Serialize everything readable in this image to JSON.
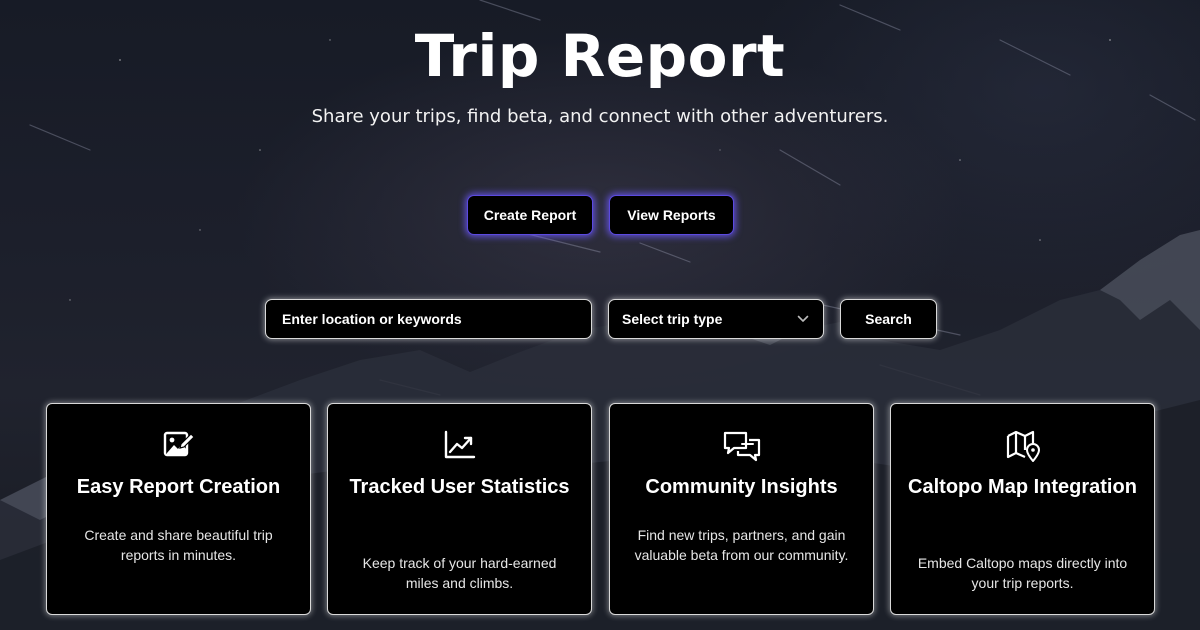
{
  "hero": {
    "title": "Trip Report",
    "subtitle": "Share your trips, find beta, and connect with other adventurers."
  },
  "actions": {
    "create_label": "Create Report",
    "view_label": "View Reports"
  },
  "search": {
    "placeholder": "Enter location or keywords",
    "trip_type_selected": "Select trip type",
    "button_label": "Search"
  },
  "features": [
    {
      "icon": "image-edit-icon",
      "title": "Easy Report Creation",
      "text": "Create and share beautiful trip reports in minutes."
    },
    {
      "icon": "chart-line-icon",
      "title": "Tracked User Statistics",
      "text": "Keep track of your hard-earned miles and climbs."
    },
    {
      "icon": "chat-bubbles-icon",
      "title": "Community Insights",
      "text": "Find new trips, partners, and gain valuable beta from our community."
    },
    {
      "icon": "map-pin-icon",
      "title": "Caltopo Map Integration",
      "text": "Embed Caltopo maps directly into your trip reports."
    }
  ],
  "colors": {
    "accent_glow": "#5b4ae0",
    "card_bg": "#000000",
    "page_bg": "#1c1f2b"
  }
}
